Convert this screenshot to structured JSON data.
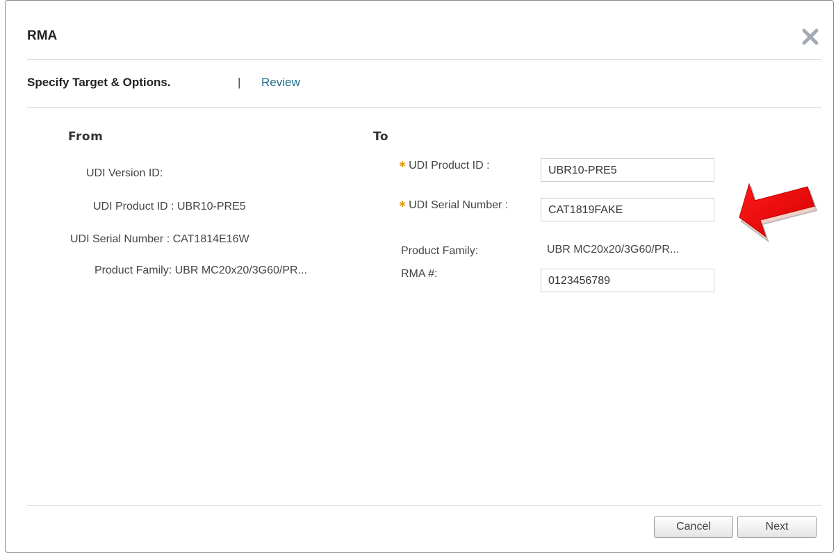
{
  "dialog": {
    "title": "RMA",
    "close_icon": "close-icon"
  },
  "steps": {
    "active": "Specify Target & Options.",
    "divider": "|",
    "next": "Review"
  },
  "from": {
    "header": "From",
    "udi_version_label": "UDI Version ID:",
    "udi_product_label": "UDI Product ID :",
    "udi_product_value": "UBR10-PRE5",
    "udi_serial_label": "UDI Serial Number :",
    "udi_serial_value": "CAT1814E16W",
    "product_family_label": "Product Family:",
    "product_family_value": "UBR MC20x20/3G60/PR..."
  },
  "to": {
    "header": "To",
    "udi_product_label": "UDI Product ID :",
    "udi_product_value": "UBR10-PRE5",
    "udi_serial_label": "UDI Serial Number :",
    "udi_serial_value": "CAT1819FAKE",
    "product_family_label": "Product Family:",
    "product_family_value": "UBR MC20x20/3G60/PR...",
    "rma_label": "RMA #:",
    "rma_value": "0123456789",
    "required_marker": "✱"
  },
  "footer": {
    "cancel_label": "Cancel",
    "next_label": "Next"
  },
  "annotation": {
    "arrow_color": "#e8000b",
    "arrow_icon": "red-arrow-pointing-left"
  }
}
